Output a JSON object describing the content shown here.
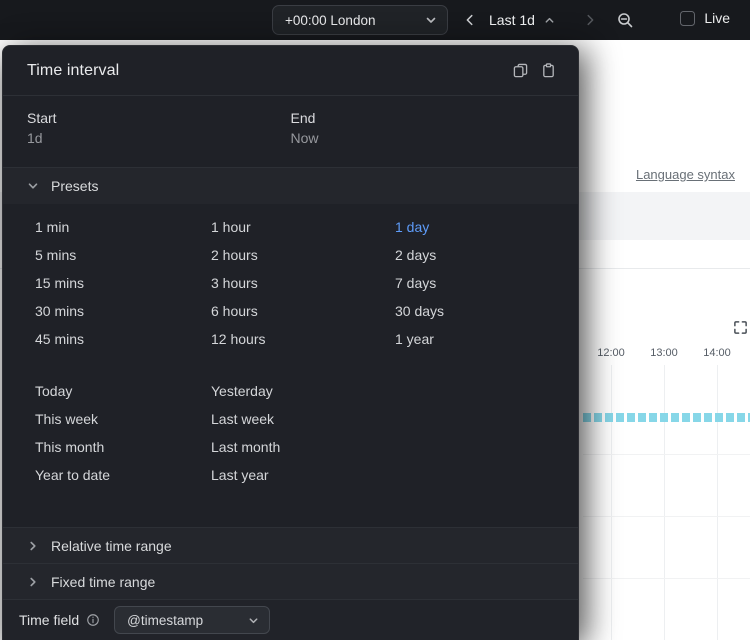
{
  "topbar": {
    "timezone": "+00:00 London",
    "range_label": "Last 1d",
    "live_label": "Live"
  },
  "popover": {
    "title": "Time interval",
    "start": {
      "label": "Start",
      "value": "1d"
    },
    "end": {
      "label": "End",
      "value": "Now"
    },
    "presets": {
      "header": "Presets",
      "selected": "1 day",
      "grid": [
        [
          "1 min",
          "1 hour",
          "1 day"
        ],
        [
          "5 mins",
          "2 hours",
          "2 days"
        ],
        [
          "15 mins",
          "3 hours",
          "7 days"
        ],
        [
          "30 mins",
          "6 hours",
          "30 days"
        ],
        [
          "45 mins",
          "12 hours",
          "1 year"
        ]
      ],
      "named": [
        [
          "Today",
          "Yesterday"
        ],
        [
          "This week",
          "Last week"
        ],
        [
          "This month",
          "Last month"
        ],
        [
          "Year to date",
          "Last year"
        ]
      ]
    },
    "relative_section_label": "Relative time range",
    "fixed_section_label": "Fixed time range",
    "time_field": {
      "label": "Time field",
      "value": "@timestamp"
    }
  },
  "background": {
    "language_syntax_label": "Language syntax",
    "chart": {
      "axis_labels": [
        "12:00",
        "13:00",
        "14:00"
      ],
      "bar_color": "#87d7e8"
    }
  },
  "icons": {
    "chevron_down": "⌄",
    "chevron_up": "⌃",
    "chevron_left": "‹",
    "chevron_right": "›",
    "zoom_out": "⊖",
    "copy": "⧉",
    "clipboard": "📋",
    "info": "ⓘ",
    "fullscreen": "⛶"
  },
  "colors": {
    "accent_blue": "#5e9cf9",
    "histogram_cyan": "#87d7e8",
    "popover_bg": "#1f2127",
    "topbar_bg": "#17191d"
  }
}
